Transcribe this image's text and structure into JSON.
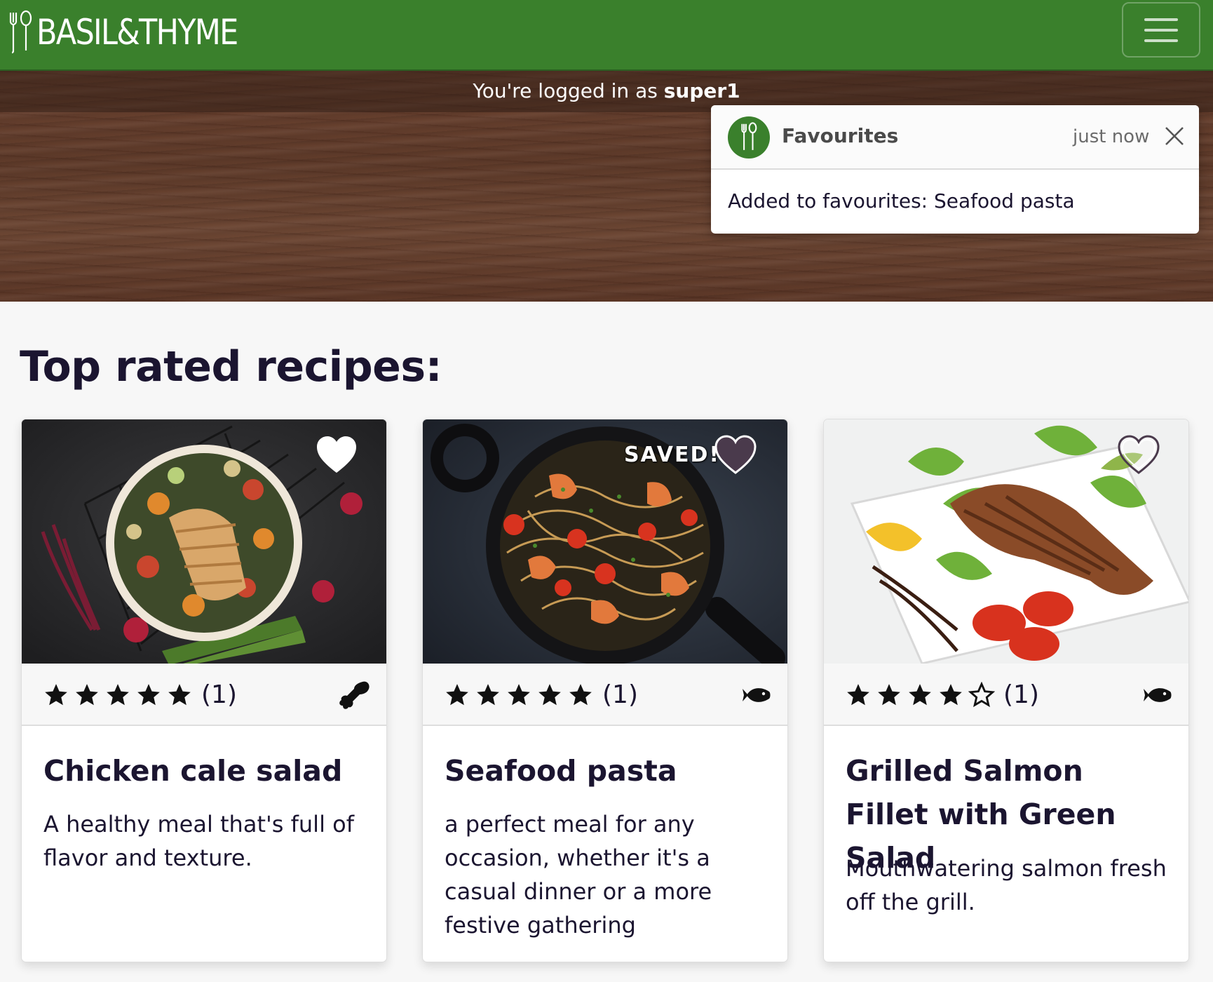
{
  "brand": {
    "name": "BASIL&THYME",
    "primary_color": "#3a802c"
  },
  "navbar": {
    "menu_icon": "hamburger-icon"
  },
  "hero": {
    "logged_in_prefix": "You're logged in as ",
    "username": "super1"
  },
  "toast": {
    "title": "Favourites",
    "time": "just now",
    "message": "Added to favourites: Seafood pasta",
    "icon": "fork-spoon-icon",
    "close_icon": "close-icon"
  },
  "section": {
    "title": "Top rated recipes:"
  },
  "recipes": [
    {
      "title": "Chicken cale salad",
      "description": "A healthy meal that's full of flavor and texture.",
      "rating": 5,
      "rating_count": "(1)",
      "category_icon": "drumstick-icon",
      "favourited": true,
      "saved_label": ""
    },
    {
      "title": "Seafood pasta",
      "description": "a perfect meal for any occasion, whether it's a casual dinner or a more festive gathering",
      "rating": 5,
      "rating_count": "(1)",
      "category_icon": "fish-icon",
      "favourited": true,
      "saved_label": "SAVED!"
    },
    {
      "title": "Grilled Salmon Fillet with Green Salad",
      "description": "Mouthwatering salmon fresh off the grill.",
      "rating": 4,
      "rating_count": "(1)",
      "category_icon": "fish-icon",
      "favourited": false,
      "saved_label": ""
    }
  ]
}
